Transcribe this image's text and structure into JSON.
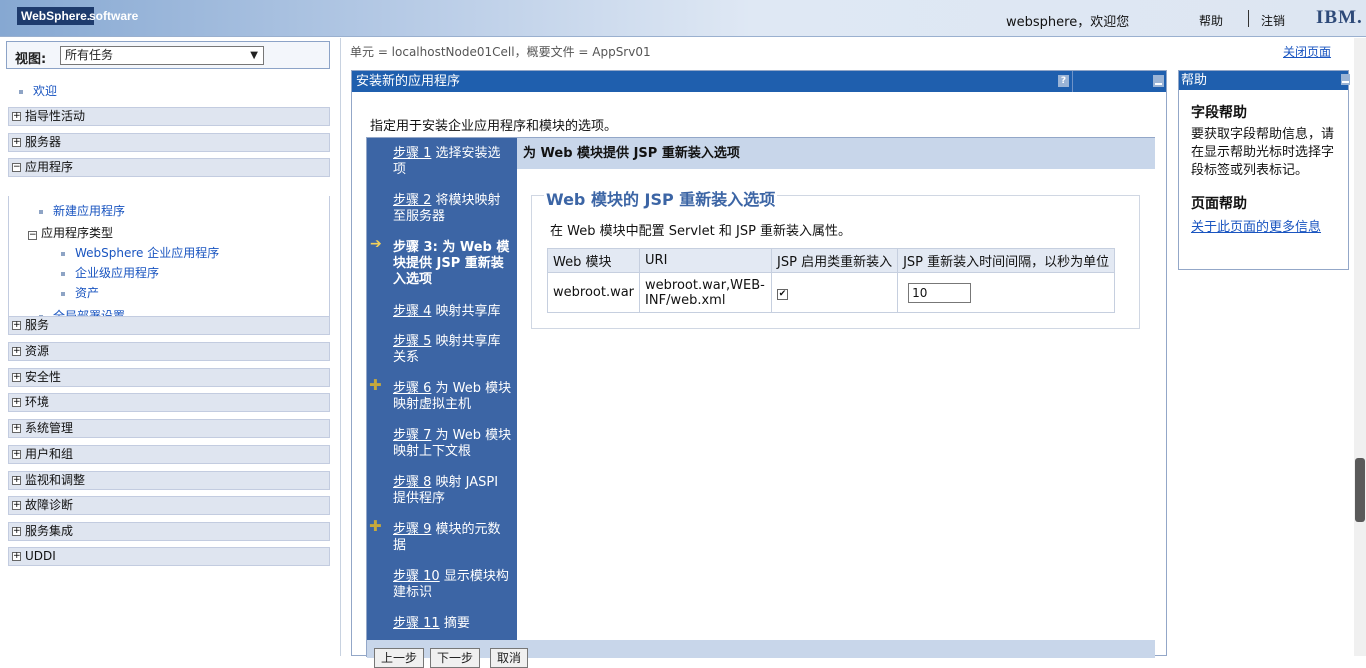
{
  "header": {
    "logo": "WebSphere.",
    "logo_suffix": "software",
    "welcome": "websphere，欢迎您",
    "help": "帮助",
    "logout": "注销",
    "brand": "IBM."
  },
  "nav": {
    "view_label": "视图:",
    "view_value": "所有任务",
    "welcome": "欢迎",
    "categories": [
      "指导性活动",
      "服务器",
      "应用程序",
      "服务",
      "资源",
      "安全性",
      "环境",
      "系统管理",
      "用户和组",
      "监视和调整",
      "故障诊断",
      "服务集成",
      "UDDI"
    ],
    "app_children": {
      "new_app": "新建应用程序",
      "app_types": "应用程序类型",
      "websphere_apps": "WebSphere 企业应用程序",
      "business_apps": "企业级应用程序",
      "assets": "资产",
      "global_deploy": "全局部署设置"
    }
  },
  "content": {
    "scope": "单元 = localhostNode01Cell，概要文件 = AppSrv01",
    "close_page": "关闭页面",
    "portlet_title": "安装新的应用程序",
    "help_q": "?",
    "intro": "指定用于安装企业应用程序和模块的选项。"
  },
  "wizard": {
    "steps": [
      {
        "num": "步骤 1",
        "text": "选择安装选项"
      },
      {
        "num": "步骤 2",
        "text": "将模块映射至服务器"
      },
      {
        "num": "步骤 3:",
        "text": "为 Web 模块提供 JSP 重新装入选项"
      },
      {
        "num": "步骤 4",
        "text": "映射共享库"
      },
      {
        "num": "步骤 5",
        "text": "映射共享库关系"
      },
      {
        "num": "步骤 6",
        "text": "为 Web 模块映射虚拟主机"
      },
      {
        "num": "步骤 7",
        "text": "为 Web 模块映射上下文根"
      },
      {
        "num": "步骤 8",
        "text": "映射 JASPI 提供程序"
      },
      {
        "num": "步骤 9",
        "text": "模块的元数据"
      },
      {
        "num": "步骤 10",
        "text": "显示模块构建标识"
      },
      {
        "num": "步骤 11",
        "text": "摘要"
      }
    ],
    "header": "为 Web 模块提供 JSP 重新装入选项",
    "legend": "Web 模块的 JSP 重新装入选项",
    "description": "在 Web 模块中配置 Servlet 和 JSP 重新装入属性。",
    "columns": [
      "Web 模块",
      "URI",
      "JSP 启用类重新装入",
      "JSP 重新装入时间间隔，以秒为单位"
    ],
    "row": {
      "module": "webroot.war",
      "uri": "webroot.war,WEB-INF/web.xml",
      "reload_enabled": true,
      "interval": "10"
    },
    "buttons": {
      "prev": "上一步",
      "next": "下一步",
      "cancel": "取消"
    }
  },
  "help": {
    "title": "帮助",
    "field_help": "字段帮助",
    "field_text": "要获取字段帮助信息，请在显示帮助光标时选择字段标签或列表标记。",
    "page_help": "页面帮助",
    "page_link": "关于此页面的更多信息"
  }
}
